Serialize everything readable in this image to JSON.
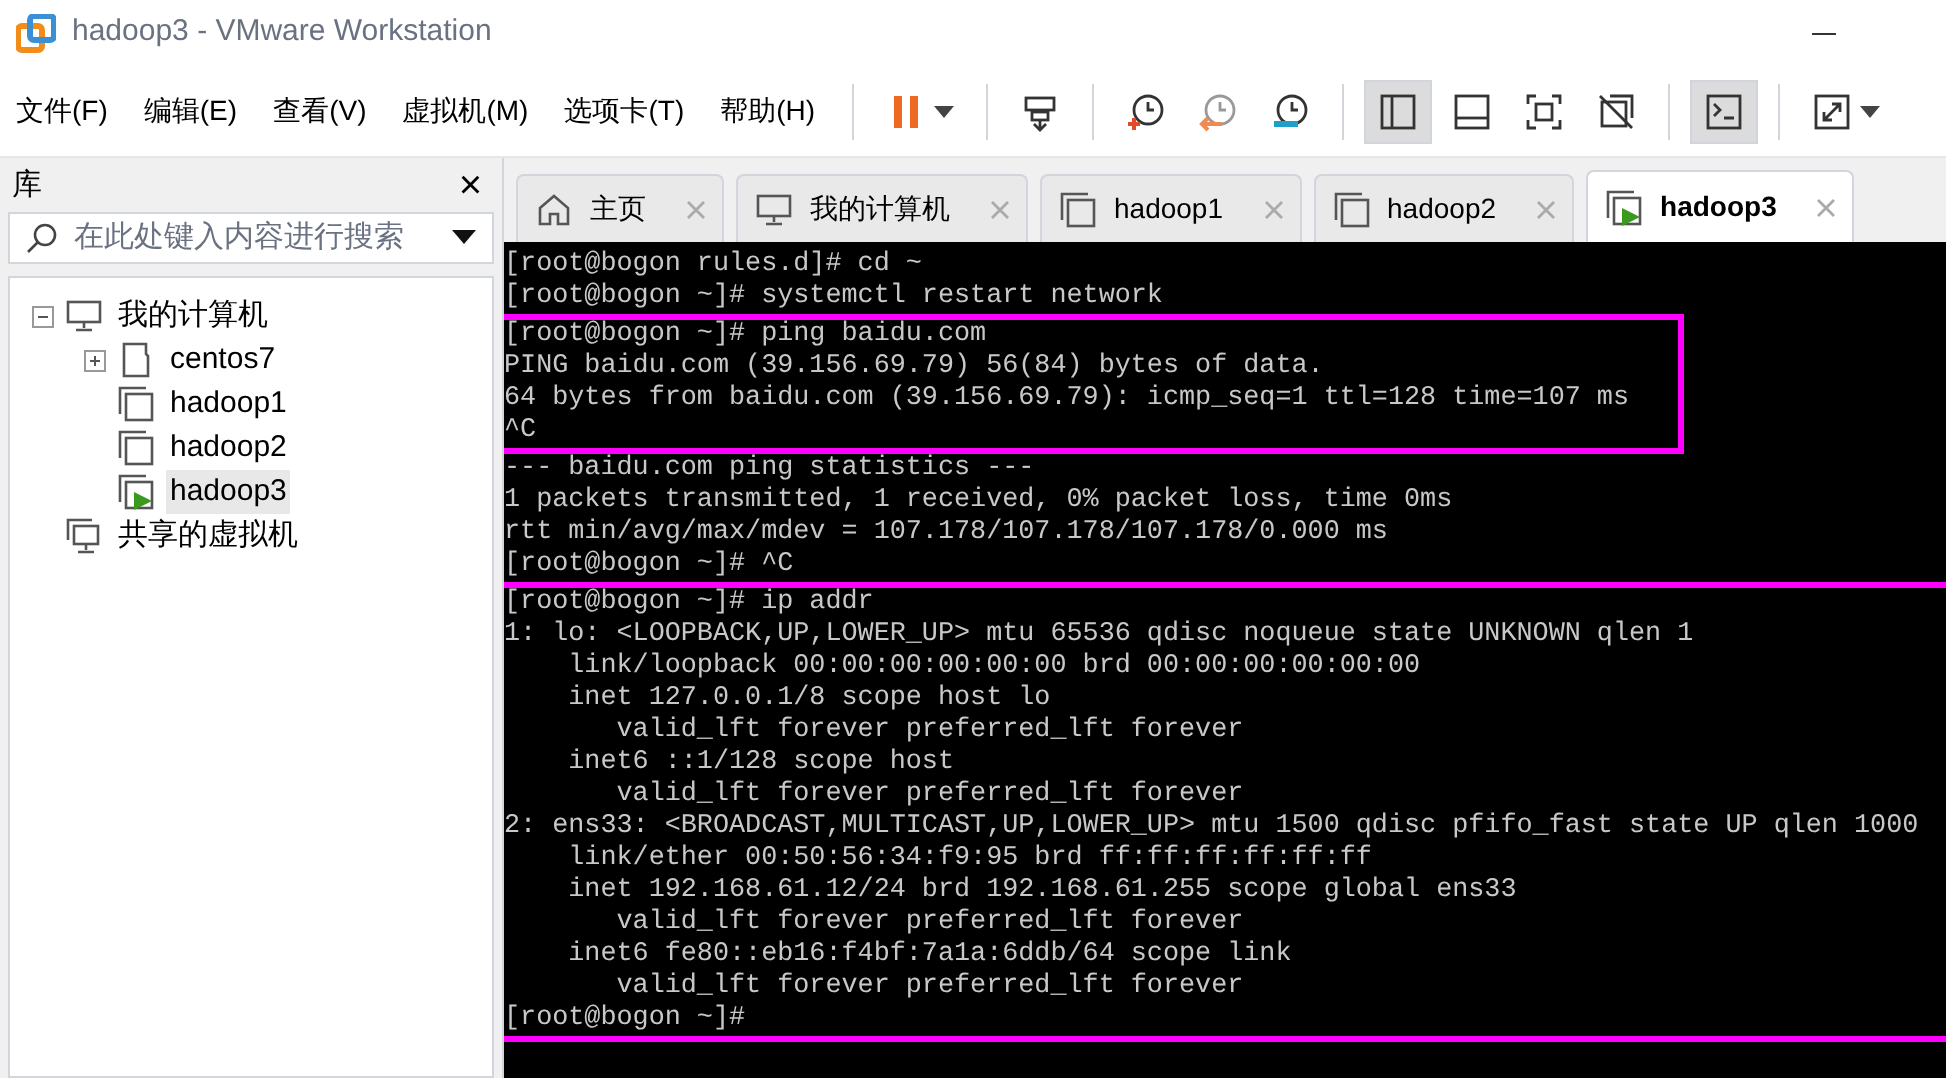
{
  "window": {
    "title": "hadoop3 - VMware Workstation"
  },
  "menu": [
    "文件(F)",
    "编辑(E)",
    "查看(V)",
    "虚拟机(M)",
    "选项卡(T)",
    "帮助(H)"
  ],
  "toolbar": [
    {
      "kind": "pause",
      "selected": false
    },
    {
      "kind": "sendkeys",
      "selected": false
    },
    {
      "kind": "snap-take",
      "selected": false
    },
    {
      "kind": "snap-revert",
      "selected": false
    },
    {
      "kind": "snap-manage",
      "selected": false
    },
    {
      "kind": "library",
      "selected": true
    },
    {
      "kind": "thumbs",
      "selected": false
    },
    {
      "kind": "fullview",
      "selected": false
    },
    {
      "kind": "unity",
      "selected": false
    },
    {
      "kind": "console",
      "selected": true
    },
    {
      "kind": "stretch",
      "selected": false
    }
  ],
  "sidebar": {
    "title": "库",
    "close": "×",
    "search": {
      "placeholder": "在此处键入内容进行搜索"
    },
    "tree": [
      {
        "label": "我的计算机",
        "kind": "computer",
        "expanded": true,
        "selected": false,
        "children": [
          {
            "label": "centos7",
            "kind": "vm-off",
            "expanded": false,
            "selected": false
          },
          {
            "label": "hadoop1",
            "kind": "vm",
            "selected": false
          },
          {
            "label": "hadoop2",
            "kind": "vm",
            "selected": false
          },
          {
            "label": "hadoop3",
            "kind": "vm-running",
            "selected": true
          }
        ]
      },
      {
        "label": "共享的虚拟机",
        "kind": "shared",
        "selected": false
      }
    ]
  },
  "tabs": [
    {
      "label": "主页",
      "kind": "home",
      "selected": false
    },
    {
      "label": "我的计算机",
      "kind": "computer",
      "selected": false
    },
    {
      "label": "hadoop1",
      "kind": "vm",
      "selected": false
    },
    {
      "label": "hadoop2",
      "kind": "vm",
      "selected": false
    },
    {
      "label": "hadoop3",
      "kind": "vm-running",
      "selected": true
    }
  ],
  "terminal": {
    "blocks": [
      {
        "highlighted": false,
        "lines": [
          "[root@bogon rules.d]# cd ~",
          "[root@bogon ~]# systemctl restart network"
        ]
      },
      {
        "highlighted": true,
        "lines": [
          "[root@bogon ~]# ping baidu.com",
          "PING baidu.com (39.156.69.79) 56(84) bytes of data.",
          "64 bytes from baidu.com (39.156.69.79): icmp_seq=1 ttl=128 time=107 ms",
          "^C"
        ]
      },
      {
        "highlighted": false,
        "lines": [
          "--- baidu.com ping statistics ---",
          "1 packets transmitted, 1 received, 0% packet loss, time 0ms",
          "rtt min/avg/max/mdev = 107.178/107.178/107.178/0.000 ms",
          "[root@bogon ~]# ^C"
        ]
      },
      {
        "highlighted": true,
        "lines": [
          "[root@bogon ~]# ip addr",
          "1: lo: <LOOPBACK,UP,LOWER_UP> mtu 65536 qdisc noqueue state UNKNOWN qlen 1",
          "    link/loopback 00:00:00:00:00:00 brd 00:00:00:00:00:00",
          "    inet 127.0.0.1/8 scope host lo",
          "       valid_lft forever preferred_lft forever",
          "    inet6 ::1/128 scope host",
          "       valid_lft forever preferred_lft forever",
          "2: ens33: <BROADCAST,MULTICAST,UP,LOWER_UP> mtu 1500 qdisc pfifo_fast state UP qlen 1000",
          "    link/ether 00:50:56:34:f9:95 brd ff:ff:ff:ff:ff:ff",
          "    inet 192.168.61.12/24 brd 192.168.61.255 scope global ens33",
          "       valid_lft forever preferred_lft forever",
          "    inet6 fe80::eb16:f4bf:7a1a:6ddb/64 scope link",
          "       valid_lft forever preferred_lft forever",
          "[root@bogon ~]#"
        ]
      }
    ]
  }
}
